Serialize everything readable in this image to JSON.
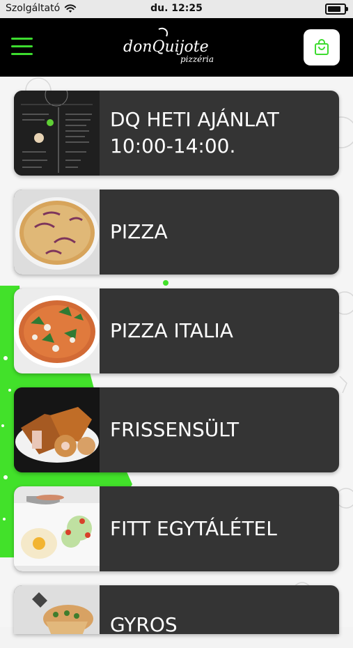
{
  "status_bar": {
    "carrier": "Szolgáltató",
    "time": "du. 12:25"
  },
  "header": {
    "logo_text_main": "donQuijote",
    "logo_text_sub": "pizzéria",
    "menu_icon": "hamburger-menu-icon",
    "cart_icon": "shopping-bag-icon",
    "accent_color": "#3ddc2f"
  },
  "categories": [
    {
      "label": "DQ HETI AJÁNLAT 10:00-14:00.",
      "thumb": "weekly-menu-board"
    },
    {
      "label": "PIZZA",
      "thumb": "pizza-photo"
    },
    {
      "label": "PIZZA ITALIA",
      "thumb": "pizza-italia-photo"
    },
    {
      "label": "FRISSENSÜLT",
      "thumb": "fried-food-photo"
    },
    {
      "label": "FITT EGYTÁLÉTEL",
      "thumb": "fit-meal-photo"
    },
    {
      "label": "GYROS",
      "thumb": "gyros-photo"
    }
  ]
}
